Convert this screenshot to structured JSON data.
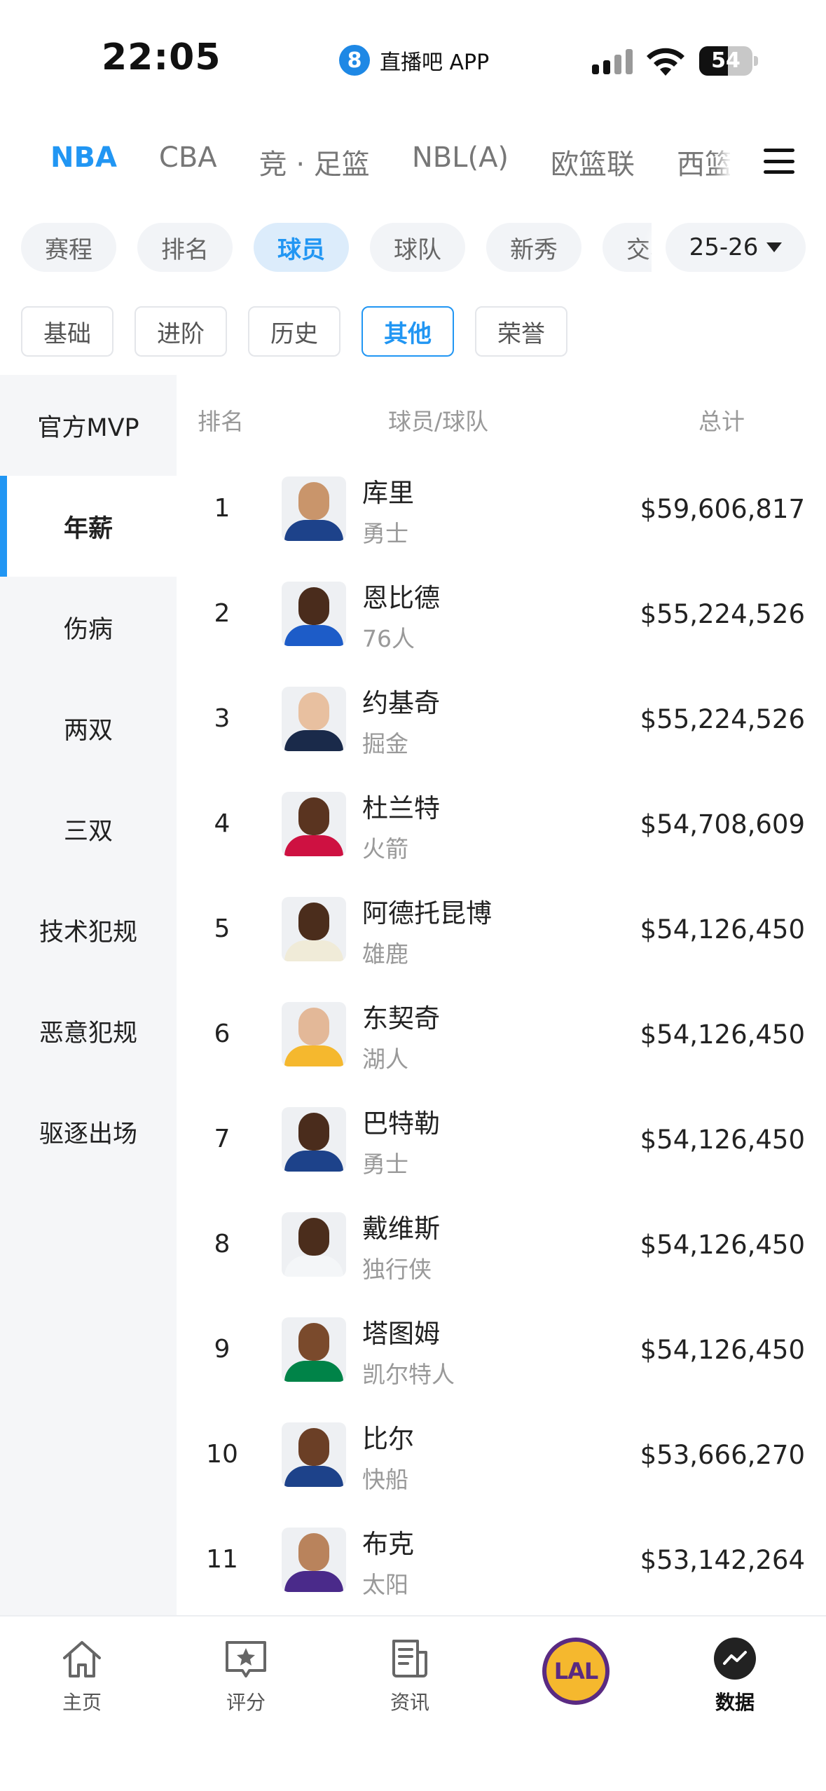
{
  "status_bar": {
    "time": "22:05",
    "app_logo_text": "8",
    "app_name": "直播吧 APP",
    "battery_level": 54,
    "battery_text": "54"
  },
  "league_tabs": [
    {
      "label": "NBA",
      "active": true
    },
    {
      "label": "CBA",
      "active": false
    },
    {
      "label": "竞 · 足篮",
      "active": false
    },
    {
      "label": "NBL(A)",
      "active": false
    },
    {
      "label": "欧篮联",
      "active": false
    },
    {
      "label": "西篮联",
      "active": false
    }
  ],
  "categories": [
    {
      "label": "赛程",
      "active": false
    },
    {
      "label": "排名",
      "active": false
    },
    {
      "label": "球员",
      "active": true
    },
    {
      "label": "球队",
      "active": false
    },
    {
      "label": "新秀",
      "active": false
    },
    {
      "label": "交易",
      "active": false
    }
  ],
  "season": "25-26",
  "sub_tabs": [
    {
      "label": "基础",
      "active": false
    },
    {
      "label": "进阶",
      "active": false
    },
    {
      "label": "历史",
      "active": false
    },
    {
      "label": "其他",
      "active": true
    },
    {
      "label": "荣誉",
      "active": false
    }
  ],
  "sidebar": [
    {
      "label": "官方MVP",
      "active": false
    },
    {
      "label": "年薪",
      "active": true
    },
    {
      "label": "伤病",
      "active": false
    },
    {
      "label": "两双",
      "active": false
    },
    {
      "label": "三双",
      "active": false
    },
    {
      "label": "技术犯规",
      "active": false
    },
    {
      "label": "恶意犯规",
      "active": false
    },
    {
      "label": "驱逐出场",
      "active": false
    }
  ],
  "table": {
    "headers": {
      "rank": "排名",
      "player": "球员/球队",
      "total": "总计"
    },
    "rows": [
      {
        "rank": "1",
        "player": "库里",
        "team": "勇士",
        "salary": "$59,606,817",
        "jersey_color": "#1d428a",
        "skin": "#c9956b"
      },
      {
        "rank": "2",
        "player": "恩比德",
        "team": "76人",
        "salary": "$55,224,526",
        "jersey_color": "#1d5cc8",
        "skin": "#4a2c1c"
      },
      {
        "rank": "3",
        "player": "约基奇",
        "team": "掘金",
        "salary": "$55,224,526",
        "jersey_color": "#1a2a4a",
        "skin": "#e8c0a0"
      },
      {
        "rank": "4",
        "player": "杜兰特",
        "team": "火箭",
        "salary": "$54,708,609",
        "jersey_color": "#ce1141",
        "skin": "#5a3420"
      },
      {
        "rank": "5",
        "player": "阿德托昆博",
        "team": "雄鹿",
        "salary": "$54,126,450",
        "jersey_color": "#f0ebd8",
        "skin": "#4b2d1c"
      },
      {
        "rank": "6",
        "player": "东契奇",
        "team": "湖人",
        "salary": "$54,126,450",
        "jersey_color": "#f5b82e",
        "skin": "#e3b898"
      },
      {
        "rank": "7",
        "player": "巴特勒",
        "team": "勇士",
        "salary": "$54,126,450",
        "jersey_color": "#1d428a",
        "skin": "#4a2c1c"
      },
      {
        "rank": "8",
        "player": "戴维斯",
        "team": "独行侠",
        "salary": "$54,126,450",
        "jersey_color": "#f4f6f8",
        "skin": "#4b2d1c"
      },
      {
        "rank": "9",
        "player": "塔图姆",
        "team": "凯尔特人",
        "salary": "$54,126,450",
        "jersey_color": "#008348",
        "skin": "#7a4a2c"
      },
      {
        "rank": "10",
        "player": "比尔",
        "team": "快船",
        "salary": "$53,666,270",
        "jersey_color": "#1d428a",
        "skin": "#6b3f26"
      },
      {
        "rank": "11",
        "player": "布克",
        "team": "太阳",
        "salary": "$53,142,264",
        "jersey_color": "#4a2a8a",
        "skin": "#b9835c"
      }
    ]
  },
  "tabbar": [
    {
      "label": "主页",
      "icon": "home-icon",
      "active": false
    },
    {
      "label": "评分",
      "icon": "rating-star-icon",
      "active": false
    },
    {
      "label": "资讯",
      "icon": "news-icon",
      "active": false
    },
    {
      "label": "",
      "icon": "lakers-logo",
      "logo_text": "LAL",
      "active": false
    },
    {
      "label": "数据",
      "icon": "data-chart-icon",
      "active": true
    }
  ]
}
